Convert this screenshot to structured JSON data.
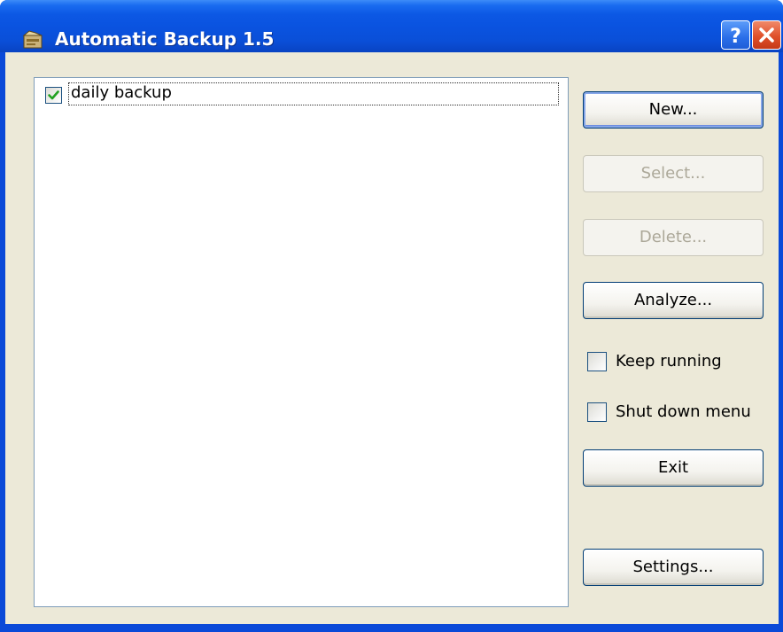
{
  "window": {
    "title": "Automatic Backup 1.5",
    "icon": "app-icon"
  },
  "titlebar_buttons": {
    "help": "?",
    "close_icon": "close-icon"
  },
  "backup_list": {
    "items": [
      {
        "label": "daily backup",
        "checked": true
      }
    ]
  },
  "buttons": {
    "new": "New...",
    "select": "Select...",
    "delete": "Delete...",
    "analyze": "Analyze...",
    "exit": "Exit",
    "settings": "Settings..."
  },
  "options": {
    "keep_running": {
      "label": "Keep running",
      "checked": false
    },
    "shut_down_menu": {
      "label": "Shut down menu",
      "checked": false
    }
  },
  "colors": {
    "titlebar": "#0a4fd8",
    "dialog_face": "#ece9d8",
    "check_green": "#21a121",
    "disabled_text": "#aca899"
  }
}
